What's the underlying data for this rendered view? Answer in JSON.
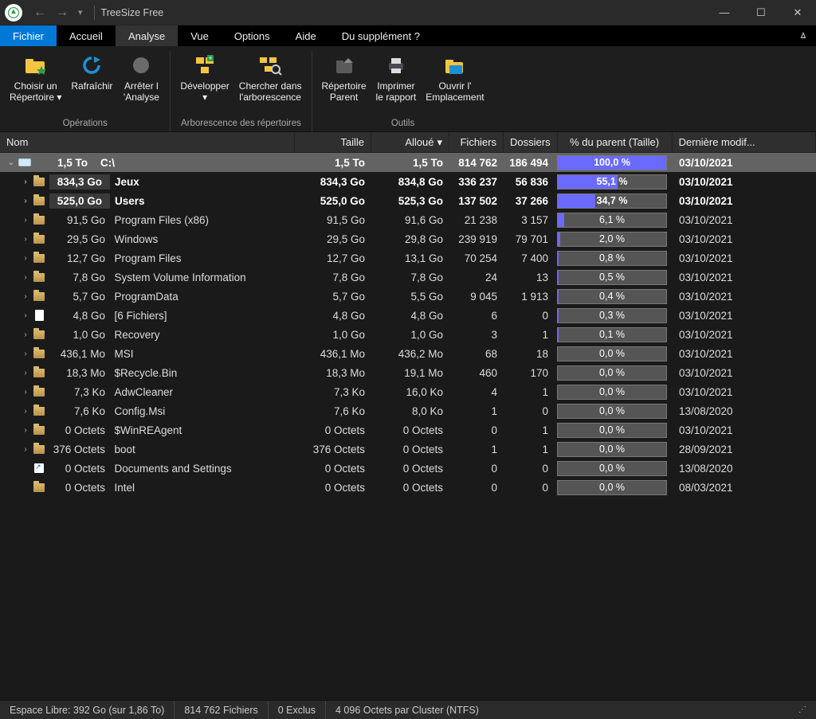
{
  "app": {
    "title": "TreeSize Free"
  },
  "menu": {
    "items": [
      "Fichier",
      "Accueil",
      "Analyse",
      "Vue",
      "Options",
      "Aide",
      "Du supplément ?"
    ],
    "active": 0,
    "hover": 2
  },
  "ribbon": {
    "groups": [
      {
        "label": "Opérations",
        "buttons": [
          {
            "id": "choose-dir",
            "label": "Choisir un\nRépertoire ▾",
            "icon": "folder-star"
          },
          {
            "id": "refresh",
            "label": "Rafraîchir",
            "icon": "refresh"
          },
          {
            "id": "stop",
            "label": "Arrêter l\n'Analyse",
            "icon": "stop"
          }
        ]
      },
      {
        "label": "Arborescence des répertoires",
        "buttons": [
          {
            "id": "expand",
            "label": "Développer\n▾",
            "icon": "expand"
          },
          {
            "id": "search-tree",
            "label": "Chercher dans\nl'arborescence",
            "icon": "search-tree"
          }
        ]
      },
      {
        "label": "Outils",
        "buttons": [
          {
            "id": "parent-dir",
            "label": "Répertoire\nParent",
            "icon": "parent"
          },
          {
            "id": "print",
            "label": "Imprimer\nle rapport",
            "icon": "printer"
          },
          {
            "id": "open-loc",
            "label": "Ouvrir l'\nEmplacement",
            "icon": "open-folder"
          }
        ]
      }
    ]
  },
  "columns": {
    "name": "Nom",
    "size": "Taille",
    "alloc": "Alloué",
    "files": "Fichiers",
    "folders": "Dossiers",
    "pct": "% du parent (Taille)",
    "date": "Dernière modif..."
  },
  "root": {
    "sizeLeft": "1,5 To",
    "name": "C:\\",
    "size": "1,5 To",
    "alloc": "1,5 To",
    "files": "814 762",
    "folders": "186 494",
    "pct": "100,0 %",
    "pctVal": 100,
    "date": "03/10/2021",
    "icon": "drive"
  },
  "rows": [
    {
      "depth": 1,
      "bold": true,
      "badge": true,
      "exp": true,
      "icon": "folder",
      "sizeLeft": "834,3 Go",
      "name": "Jeux",
      "size": "834,3 Go",
      "alloc": "834,8 Go",
      "files": "336 237",
      "folders": "56 836",
      "pct": "55,1 %",
      "pctVal": 55.1,
      "date": "03/10/2021"
    },
    {
      "depth": 1,
      "bold": true,
      "badge": true,
      "exp": true,
      "icon": "folder",
      "sizeLeft": "525,0 Go",
      "name": "Users",
      "size": "525,0 Go",
      "alloc": "525,3 Go",
      "files": "137 502",
      "folders": "37 266",
      "pct": "34,7 %",
      "pctVal": 34.7,
      "date": "03/10/2021"
    },
    {
      "depth": 1,
      "exp": true,
      "icon": "folder",
      "sizeLeft": "91,5 Go",
      "name": "Program Files (x86)",
      "size": "91,5 Go",
      "alloc": "91,6 Go",
      "files": "21 238",
      "folders": "3 157",
      "pct": "6,1 %",
      "pctVal": 6.1,
      "date": "03/10/2021"
    },
    {
      "depth": 1,
      "exp": true,
      "icon": "folder",
      "sizeLeft": "29,5 Go",
      "name": "Windows",
      "size": "29,5 Go",
      "alloc": "29,8 Go",
      "files": "239 919",
      "folders": "79 701",
      "pct": "2,0 %",
      "pctVal": 2.0,
      "date": "03/10/2021"
    },
    {
      "depth": 1,
      "exp": true,
      "icon": "folder",
      "sizeLeft": "12,7 Go",
      "name": "Program Files",
      "size": "12,7 Go",
      "alloc": "13,1 Go",
      "files": "70 254",
      "folders": "7 400",
      "pct": "0,8 %",
      "pctVal": 0.8,
      "date": "03/10/2021"
    },
    {
      "depth": 1,
      "exp": true,
      "icon": "folder",
      "sizeLeft": "7,8 Go",
      "name": "System Volume Information",
      "size": "7,8 Go",
      "alloc": "7,8 Go",
      "files": "24",
      "folders": "13",
      "pct": "0,5 %",
      "pctVal": 0.5,
      "date": "03/10/2021"
    },
    {
      "depth": 1,
      "exp": true,
      "icon": "folder",
      "sizeLeft": "5,7 Go",
      "name": "ProgramData",
      "size": "5,7 Go",
      "alloc": "5,5 Go",
      "files": "9 045",
      "folders": "1 913",
      "pct": "0,4 %",
      "pctVal": 0.4,
      "date": "03/10/2021"
    },
    {
      "depth": 1,
      "exp": true,
      "icon": "file",
      "sizeLeft": "4,8 Go",
      "name": "[6 Fichiers]",
      "size": "4,8 Go",
      "alloc": "4,8 Go",
      "files": "6",
      "folders": "0",
      "pct": "0,3 %",
      "pctVal": 0.3,
      "date": "03/10/2021"
    },
    {
      "depth": 1,
      "exp": true,
      "icon": "folder",
      "sizeLeft": "1,0 Go",
      "name": "Recovery",
      "size": "1,0 Go",
      "alloc": "1,0 Go",
      "files": "3",
      "folders": "1",
      "pct": "0,1 %",
      "pctVal": 0.1,
      "date": "03/10/2021"
    },
    {
      "depth": 1,
      "exp": true,
      "icon": "folder",
      "sizeLeft": "436,1 Mo",
      "name": "MSI",
      "size": "436,1 Mo",
      "alloc": "436,2 Mo",
      "files": "68",
      "folders": "18",
      "pct": "0,0 %",
      "pctVal": 0,
      "date": "03/10/2021"
    },
    {
      "depth": 1,
      "exp": true,
      "icon": "folder",
      "sizeLeft": "18,3 Mo",
      "name": "$Recycle.Bin",
      "size": "18,3 Mo",
      "alloc": "19,1 Mo",
      "files": "460",
      "folders": "170",
      "pct": "0,0 %",
      "pctVal": 0,
      "date": "03/10/2021"
    },
    {
      "depth": 1,
      "exp": true,
      "icon": "folder",
      "sizeLeft": "7,3 Ko",
      "name": "AdwCleaner",
      "size": "7,3 Ko",
      "alloc": "16,0 Ko",
      "files": "4",
      "folders": "1",
      "pct": "0,0 %",
      "pctVal": 0,
      "date": "03/10/2021"
    },
    {
      "depth": 1,
      "exp": true,
      "icon": "folder",
      "sizeLeft": "7,6 Ko",
      "name": "Config.Msi",
      "size": "7,6 Ko",
      "alloc": "8,0 Ko",
      "files": "1",
      "folders": "0",
      "pct": "0,0 %",
      "pctVal": 0,
      "date": "13/08/2020"
    },
    {
      "depth": 1,
      "exp": true,
      "icon": "folder",
      "sizeLeft": "0 Octets",
      "name": "$WinREAgent",
      "size": "0 Octets",
      "alloc": "0 Octets",
      "files": "0",
      "folders": "1",
      "pct": "0,0 %",
      "pctVal": 0,
      "date": "03/10/2021"
    },
    {
      "depth": 1,
      "exp": true,
      "icon": "folder",
      "sizeLeft": "376 Octets",
      "name": "boot",
      "size": "376 Octets",
      "alloc": "0 Octets",
      "files": "1",
      "folders": "1",
      "pct": "0,0 %",
      "pctVal": 0,
      "date": "28/09/2021"
    },
    {
      "depth": 1,
      "exp": false,
      "icon": "shortcut",
      "sizeLeft": "0 Octets",
      "name": "Documents and Settings",
      "size": "0 Octets",
      "alloc": "0 Octets",
      "files": "0",
      "folders": "0",
      "pct": "0,0 %",
      "pctVal": 0,
      "date": "13/08/2020"
    },
    {
      "depth": 1,
      "exp": false,
      "icon": "folder",
      "sizeLeft": "0 Octets",
      "name": "Intel",
      "size": "0 Octets",
      "alloc": "0 Octets",
      "files": "0",
      "folders": "0",
      "pct": "0,0 %",
      "pctVal": 0,
      "date": "08/03/2021"
    }
  ],
  "status": {
    "free": "Espace Libre: 392 Go  (sur 1,86 To)",
    "files": "814 762 Fichiers",
    "exclus": "0 Exclus",
    "cluster": "4 096 Octets par Cluster (NTFS)"
  }
}
